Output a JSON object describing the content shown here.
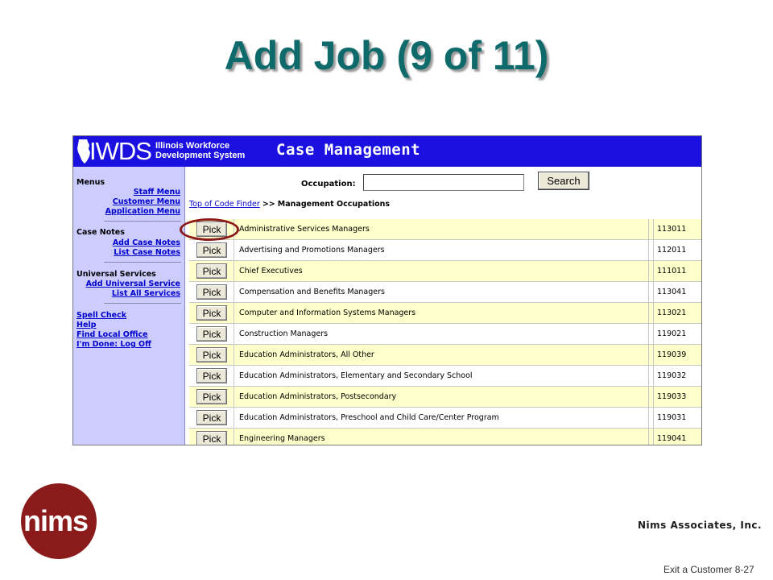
{
  "slide": {
    "title": "Add Job (9 of 11)",
    "company": "Nims Associates, Inc.",
    "logo_text": "nims",
    "footer": "Exit a Customer 8-27"
  },
  "app": {
    "logo_text": "IWDS",
    "org_name_line1": "Illinois Workforce",
    "org_name_line2": "Development System",
    "module": "Case Management",
    "header_color": "#1a10e0",
    "sidebar_color": "#ccccff"
  },
  "sidebar": {
    "menus_heading": "Menus",
    "staff_menu": "Staff Menu",
    "customer_menu": "Customer Menu",
    "application_menu": "Application Menu",
    "case_notes_heading": "Case Notes",
    "add_case_notes": "Add Case Notes",
    "list_case_notes": "List Case Notes",
    "universal_services_heading": "Universal Services",
    "add_universal_service": "Add Universal Service",
    "list_all_services": "List All Services",
    "spell_check": "Spell Check",
    "help": "Help",
    "find_local_office": "Find Local Office",
    "log_off": "I'm Done: Log Off"
  },
  "search": {
    "label": "Occupation:",
    "value": "",
    "button": "Search"
  },
  "breadcrumb": {
    "link": "Top of Code Finder",
    "separator": ">>",
    "current": "Management Occupations"
  },
  "pick_label": "Pick",
  "occupations": [
    {
      "title": "Administrative Services Managers",
      "code": "113011"
    },
    {
      "title": "Advertising and Promotions Managers",
      "code": "112011"
    },
    {
      "title": "Chief Executives",
      "code": "111011"
    },
    {
      "title": "Compensation and Benefits Managers",
      "code": "113041"
    },
    {
      "title": "Computer and Information Systems Managers",
      "code": "113021"
    },
    {
      "title": "Construction Managers",
      "code": "119021"
    },
    {
      "title": "Education Administrators, All Other",
      "code": "119039"
    },
    {
      "title": "Education Administrators, Elementary and Secondary School",
      "code": "119032"
    },
    {
      "title": "Education Administrators, Postsecondary",
      "code": "119033"
    },
    {
      "title": "Education Administrators, Preschool and Child Care/Center Program",
      "code": "119031"
    },
    {
      "title": "Engineering Managers",
      "code": "119041"
    }
  ],
  "highlight_color": "#8b1a1a"
}
